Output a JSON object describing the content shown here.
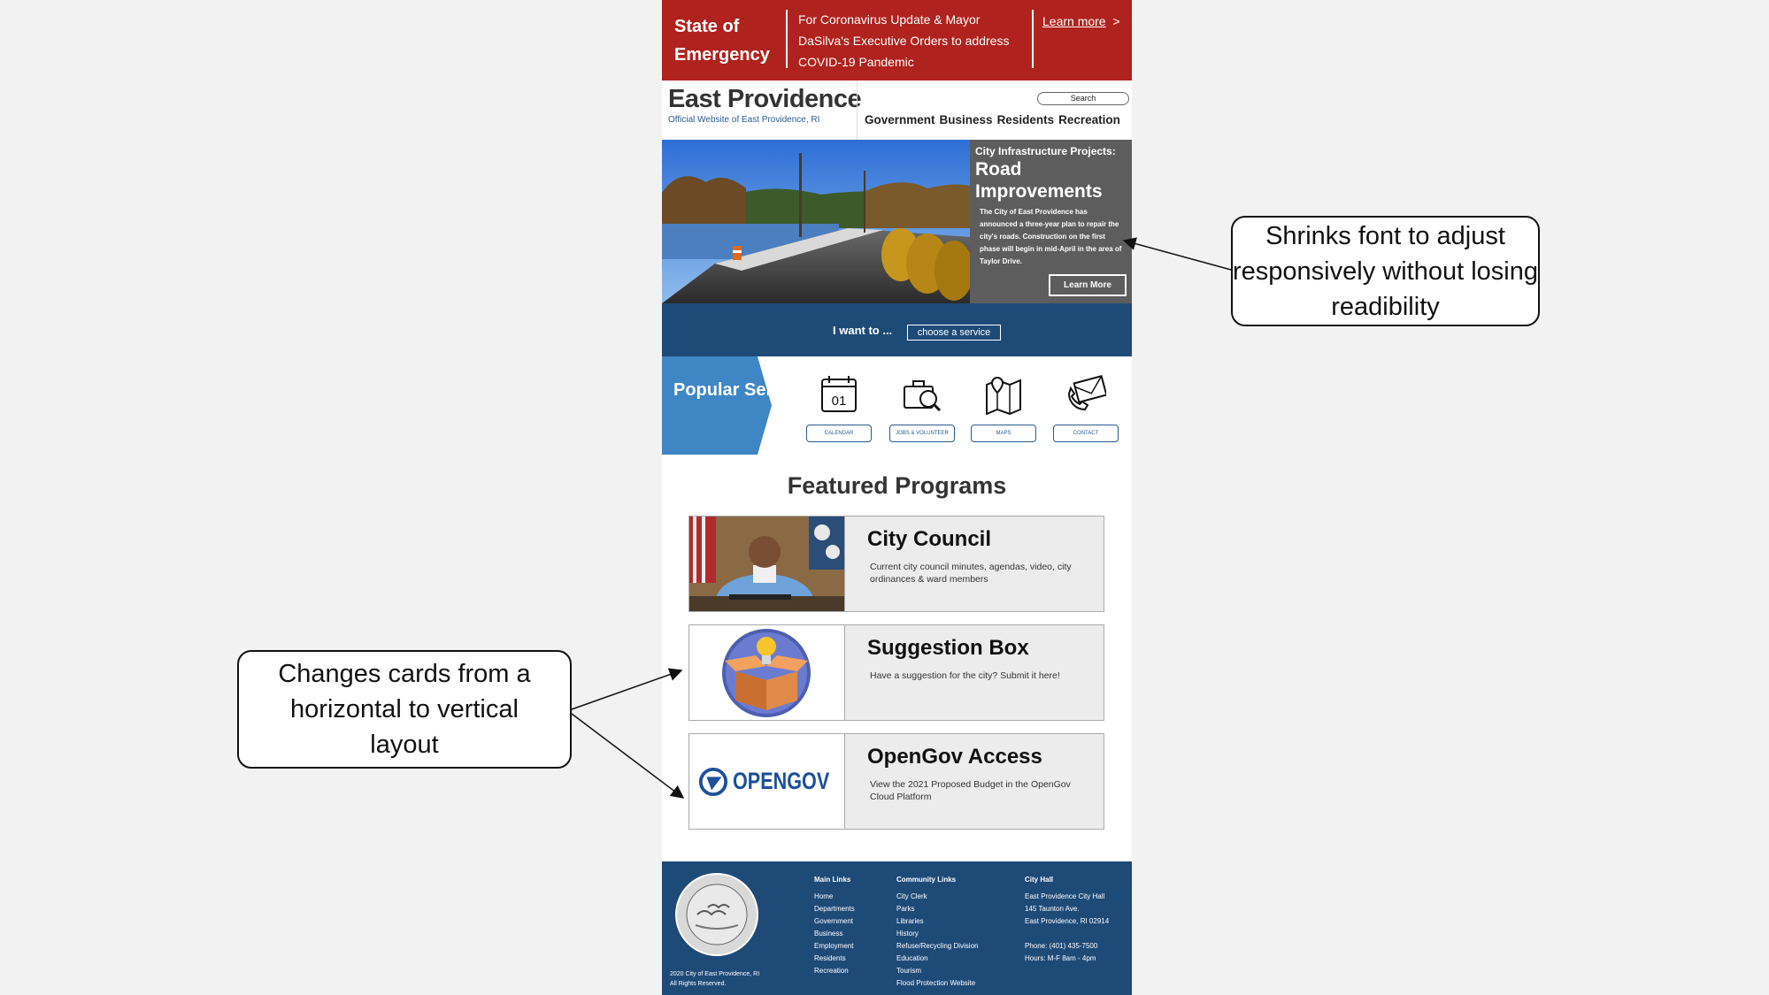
{
  "alert": {
    "title": "State of Emergency",
    "message": "For Coronavirus Update & Mayor DaSilva's Executive Orders to address COVID-19 Pandemic",
    "link": "Learn more",
    "link_chevron": ">"
  },
  "header": {
    "brand": "East Providence",
    "subtitle": "Official Website of East Providence, RI",
    "search_placeholder": "Search",
    "nav": [
      "Government",
      "Business",
      "Residents",
      "Recreation"
    ]
  },
  "hero": {
    "kicker": "City Infrastructure Projects:",
    "title": "Road Improvements",
    "body": "The City of East Providence has announced a three-year plan to repair the city's roads. Construction on the first phase will begin in mid-April in the area of Taylor Drive.",
    "button": "Learn More"
  },
  "iwant": {
    "label": "I want to ...",
    "select": "choose a service"
  },
  "popular": {
    "label": "Popular Service",
    "items": [
      {
        "label": "CALENDAR",
        "icon": "calendar-icon",
        "icon_text": "01"
      },
      {
        "label": "JOBS & VOLUNTEER",
        "icon": "briefcase-search-icon"
      },
      {
        "label": "MAPS",
        "icon": "map-pin-icon"
      },
      {
        "label": "CONTACT",
        "icon": "envelope-phone-icon"
      }
    ]
  },
  "featured": {
    "title": "Featured Programs",
    "cards": [
      {
        "title": "City Council",
        "desc": "Current city council minutes, agendas, video, city ordinances & ward members"
      },
      {
        "title": "Suggestion Box",
        "desc": "Have a suggestion for the city? Submit it here!"
      },
      {
        "title": "OpenGov Access",
        "desc": "View the 2021 Proposed Budget in the OpenGov Cloud Platform",
        "logo_text": "OPENGOV"
      }
    ]
  },
  "footer": {
    "copyright": [
      "2020 City of East Providence, RI",
      "All Rights Reserved."
    ],
    "main_links": {
      "heading": "Main Links",
      "items": [
        "Home",
        "Departments",
        "Government",
        "Business",
        "Employment",
        "Residents",
        "Recreation"
      ]
    },
    "community_links": {
      "heading": "Community Links",
      "items": [
        "City Clerk",
        "Parks",
        "Libraries",
        "History",
        "Refuse/Recycling Division",
        "Education",
        "Tourism",
        "Flood Protection Website"
      ]
    },
    "city_hall": {
      "heading": "City Hall",
      "lines": [
        "East Providence City Hall",
        "145 Taunton Ave.",
        "East Providence, RI 02914",
        "",
        "Phone: (401) 435-7500",
        "Hours: M-F 8am - 4pm"
      ]
    }
  },
  "annotations": {
    "right": "Shrinks font to adjust responsively without losing readibility",
    "left": "Changes cards from a horizontal to vertical layout"
  },
  "colors": {
    "alert_red": "#b0221e",
    "navy": "#1e4a78",
    "light_blue": "#3f86c5",
    "hero_panel": "#5d5d5d"
  }
}
